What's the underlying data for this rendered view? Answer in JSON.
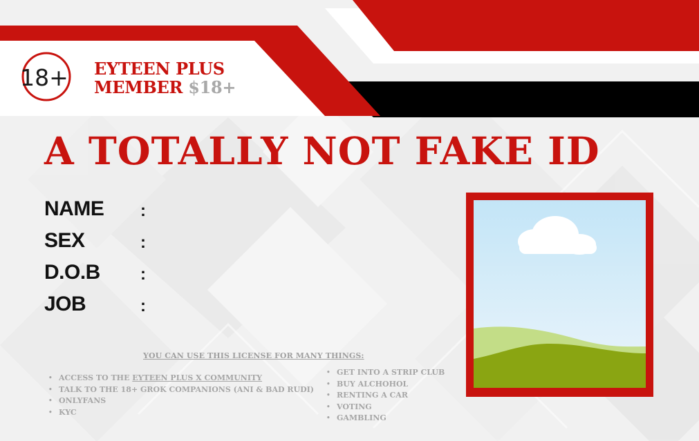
{
  "brand": {
    "logo_text": "18+",
    "line1": "EYTEEN PLUS",
    "line2": "MEMBER",
    "price": "$18+"
  },
  "title": "A TOTALLY NOT FAKE ID",
  "fields": [
    {
      "label": "NAME",
      "colon": ":"
    },
    {
      "label": "SEX",
      "colon": ":"
    },
    {
      "label": "D.O.B",
      "colon": ":"
    },
    {
      "label": "JOB",
      "colon": ":"
    }
  ],
  "uses": {
    "heading": "YOU CAN USE THIS LICENSE FOR MANY THINGS:",
    "left": [
      {
        "prefix": "ACCESS TO THE ",
        "link": "EYTEEN PLUS X COMMUNITY "
      },
      {
        "text": "TALK TO THE 18+ GROK COMPANIONS (ANI & BAD RUDI)"
      },
      {
        "text": "ONLYFANS"
      },
      {
        "text": "KYC"
      }
    ],
    "right": [
      "GET INTO A STRIP CLUB",
      "BUY ALCHOHOL",
      "RENTING A CAR",
      "VOTING",
      "GAMBLING"
    ]
  },
  "colors": {
    "accent_red": "#c8130e",
    "black_bar": "#000000",
    "muted_gray": "#a9a9a9"
  },
  "icons": {
    "logo": "circled-18-plus-icon",
    "photo": "landscape-placeholder-icon"
  }
}
